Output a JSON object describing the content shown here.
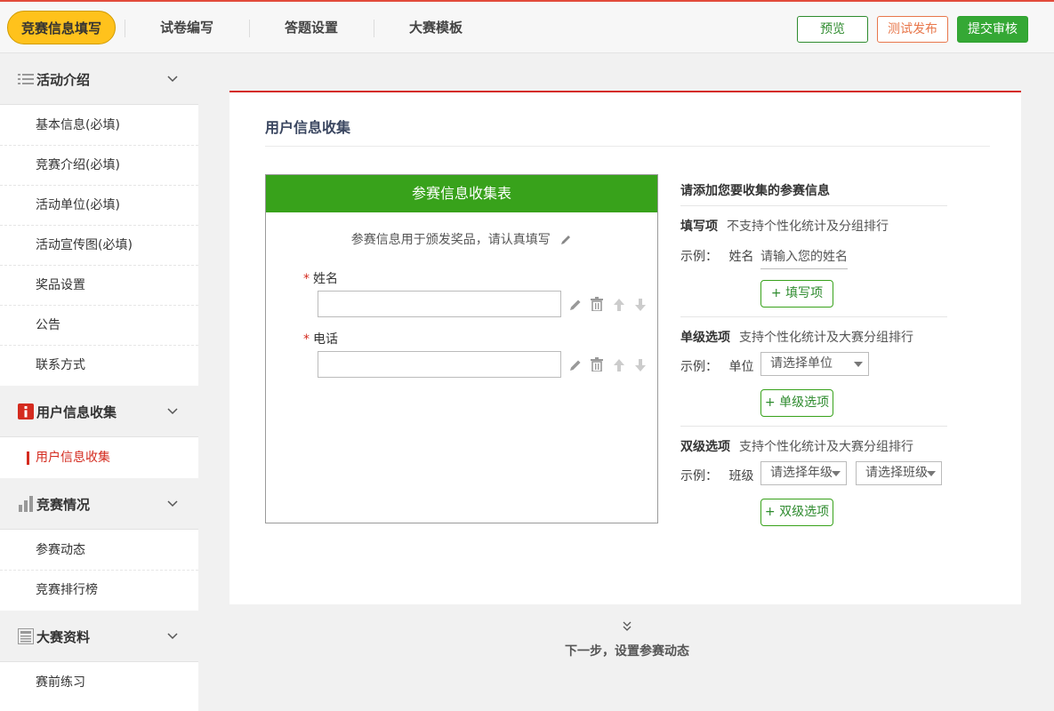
{
  "topbar": {
    "tabs": [
      {
        "label": "竞赛信息填写"
      },
      {
        "label": "试卷编写"
      },
      {
        "label": "答题设置"
      },
      {
        "label": "大赛模板"
      }
    ],
    "buttons": {
      "preview": "预览",
      "test_publish": "测试发布",
      "submit_review": "提交审核"
    }
  },
  "sidebar": {
    "groups": [
      {
        "label": "活动介绍",
        "icon": "list-icon",
        "items": [
          "基本信息(必填)",
          "竞赛介绍(必填)",
          "活动单位(必填)",
          "活动宣传图(必填)",
          "奖品设置",
          "公告",
          "联系方式"
        ]
      },
      {
        "label": "用户信息收集",
        "icon": "info-icon",
        "items": [
          "用户信息收集"
        ]
      },
      {
        "label": "竞赛情况",
        "icon": "bar-chart-icon",
        "items": [
          "参赛动态",
          "竞赛排行榜"
        ]
      },
      {
        "label": "大赛资料",
        "icon": "document-icon",
        "items": [
          "赛前练习"
        ]
      }
    ],
    "active_item": "用户信息收集"
  },
  "main": {
    "title": "用户信息收集",
    "form": {
      "header": "参赛信息收集表",
      "description": "参赛信息用于颁发奖品，请认真填写",
      "fields": [
        {
          "label": "姓名",
          "required": "*",
          "value": ""
        },
        {
          "label": "电话",
          "required": "*",
          "value": ""
        }
      ]
    },
    "panel": {
      "title": "请添加您要收集的参赛信息",
      "fill": {
        "name": "填写项",
        "desc": "不支持个性化统计及分组排行",
        "example_label": "示例：",
        "example_field": "姓名",
        "example_placeholder": "请输入您的姓名",
        "button": "+ 填写项"
      },
      "single": {
        "name": "单级选项",
        "desc": "支持个性化统计及大赛分组排行",
        "example_label": "示例：",
        "example_field": "单位",
        "select": "请选择单位",
        "button": "+ 单级选项"
      },
      "double": {
        "name": "双级选项",
        "desc": "支持个性化统计及大赛分组排行",
        "example_label": "示例：",
        "example_field": "班级",
        "select1": "请选择年级",
        "select2": "请选择班级",
        "button": "+ 双级选项"
      }
    },
    "next_step": "下一步，设置参赛动态"
  },
  "colors": {
    "accent_red": "#d42b1f",
    "green": "#38a21b",
    "active_tab": "#ffc21c",
    "test_orange": "#e8774b"
  }
}
